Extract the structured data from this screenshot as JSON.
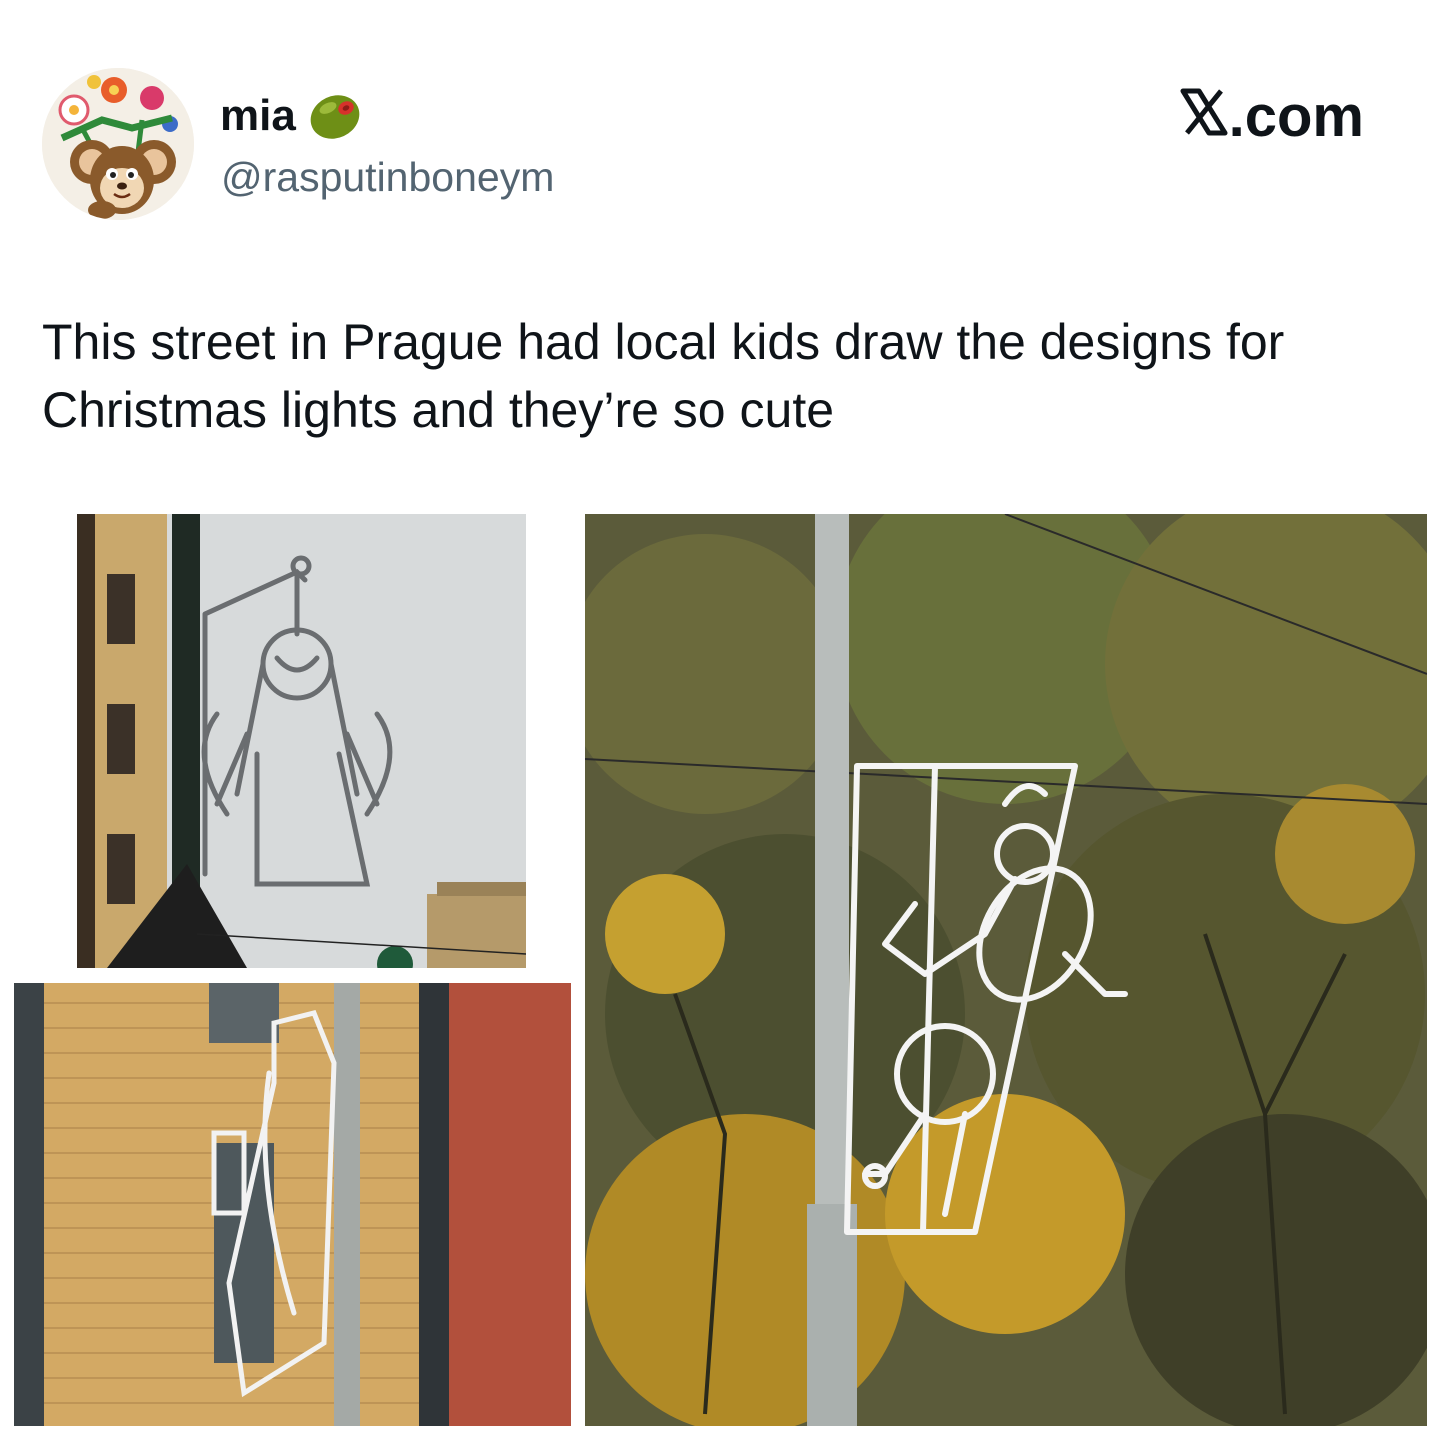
{
  "user": {
    "display_name": "mia",
    "handle": "@rasputinboneym",
    "avatar_icon": "cartoon-character-with-flowers-avatar",
    "name_emoji_icon": "olive-icon"
  },
  "site": {
    "logo_label": ".com",
    "logo_icon": "x-logo-icon"
  },
  "tweet": {
    "text": "This street in Prague had local kids draw the designs for Christmas lights and they’re so cute"
  },
  "photos": [
    {
      "subject": "angel-shaped light decoration on street pole against cloudy sky"
    },
    {
      "subject": "light decoration on pole in front of brick building"
    },
    {
      "subject": "stick-figure light decoration on lamp pole in front of autumn trees"
    }
  ],
  "colors": {
    "text_primary": "#0f1419",
    "text_secondary": "#536471",
    "olive_green": "#6e8f16",
    "olive_pimento": "#d6322b"
  }
}
